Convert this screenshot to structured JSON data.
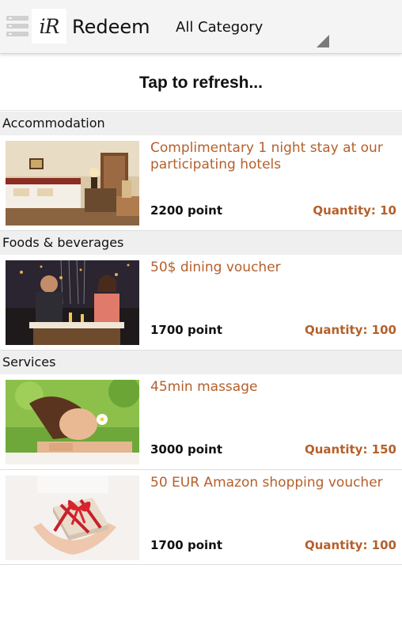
{
  "header": {
    "logo_text": "iR",
    "title": "Redeem",
    "category_select": {
      "value": "All Category"
    }
  },
  "refresh_label": "Tap to refresh...",
  "sections": [
    {
      "name": "Accommodation",
      "items": [
        {
          "title": "Complimentary 1 night stay at our participating hotels",
          "points": "2200 point",
          "quantity": "Quantity: 10",
          "image": "hotel-room-photo"
        }
      ]
    },
    {
      "name": "Foods & beverages",
      "items": [
        {
          "title": "50$ dining voucher",
          "points": "1700 point",
          "quantity": "Quantity: 100",
          "image": "dining-couple-photo"
        }
      ]
    },
    {
      "name": "Services",
      "items": [
        {
          "title": "45min massage",
          "points": "3000 point",
          "quantity": "Quantity: 150",
          "image": "spa-massage-photo"
        },
        {
          "title": "50 EUR Amazon shopping voucher",
          "points": "1700 point",
          "quantity": "Quantity: 100",
          "image": "gift-box-photo"
        }
      ]
    }
  ],
  "colors": {
    "accent": "#b5602b",
    "header_bg": "#f4f4f4",
    "section_bg": "#efefef"
  }
}
